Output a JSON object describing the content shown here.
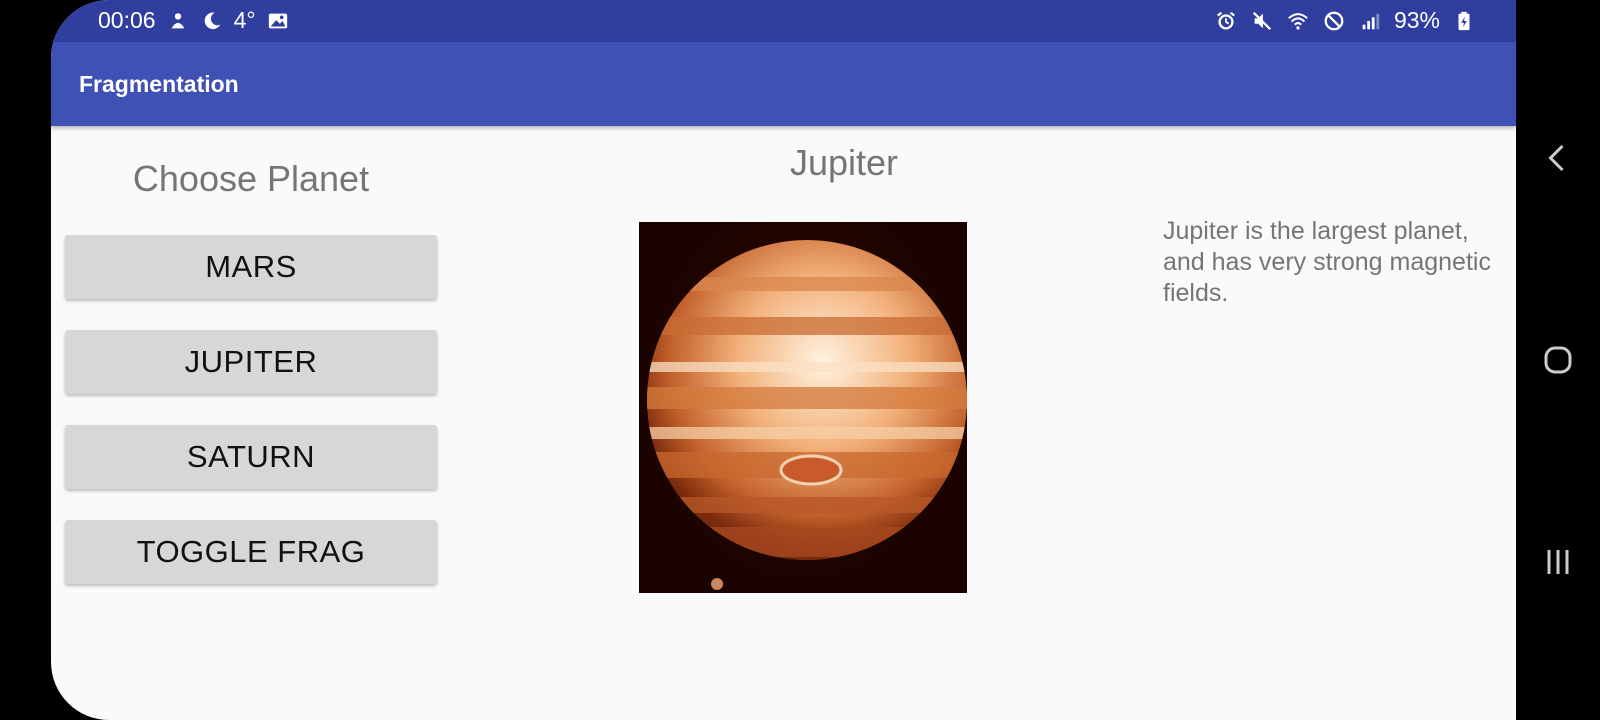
{
  "status_bar": {
    "time": "00:06",
    "temperature": "4°",
    "battery": "93%",
    "left_icons": [
      "notification-icon",
      "moon-icon",
      "image-icon"
    ],
    "right_icons": [
      "alarm-icon",
      "mute-icon",
      "wifi-icon",
      "no-sim-icon",
      "signal-icon",
      "battery-icon"
    ]
  },
  "app_bar": {
    "title": "Fragmentation"
  },
  "left_pane": {
    "title": "Choose Planet",
    "buttons": [
      "MARS",
      "JUPITER",
      "SATURN",
      "TOGGLE FRAG"
    ]
  },
  "detail": {
    "planet_name": "Jupiter",
    "description": "Jupiter is the largest planet, and has very strong magnetic fields."
  },
  "nav_bar": {
    "icons": [
      "back-icon",
      "home-icon",
      "recents-icon"
    ]
  },
  "colors": {
    "status_bar": "#303f9f",
    "app_bar": "#3f51b5",
    "background": "#fafafa",
    "button": "#d6d7d7",
    "muted_text": "#757575"
  }
}
